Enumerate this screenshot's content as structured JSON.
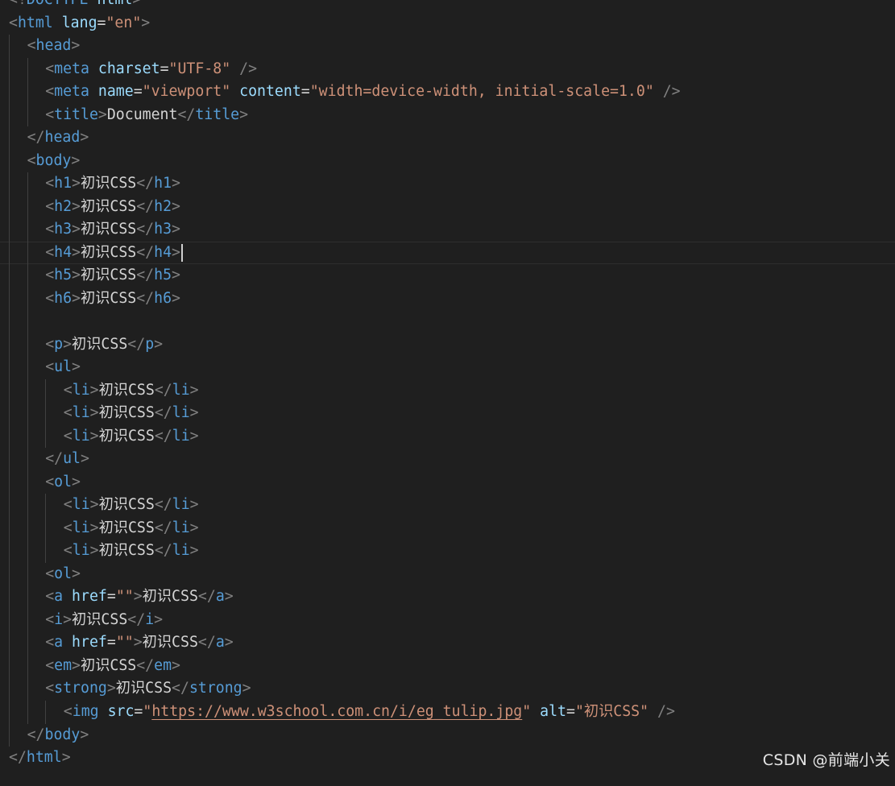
{
  "editor": {
    "cursor_line": 11,
    "lines": [
      {
        "indent": 0,
        "tokens": [
          {
            "k": "punc",
            "t": "<!"
          },
          {
            "k": "tag",
            "t": "DOCTYPE"
          },
          {
            "k": "text",
            "t": " "
          },
          {
            "k": "attr",
            "t": "html"
          },
          {
            "k": "punc",
            "t": ">"
          }
        ]
      },
      {
        "indent": 0,
        "tokens": [
          {
            "k": "punc",
            "t": "<"
          },
          {
            "k": "tag",
            "t": "html"
          },
          {
            "k": "text",
            "t": " "
          },
          {
            "k": "attr",
            "t": "lang"
          },
          {
            "k": "op",
            "t": "="
          },
          {
            "k": "str",
            "t": "\"en\""
          },
          {
            "k": "punc",
            "t": ">"
          }
        ]
      },
      {
        "indent": 1,
        "tokens": [
          {
            "k": "punc",
            "t": "<"
          },
          {
            "k": "tag",
            "t": "head"
          },
          {
            "k": "punc",
            "t": ">"
          }
        ]
      },
      {
        "indent": 2,
        "tokens": [
          {
            "k": "punc",
            "t": "<"
          },
          {
            "k": "tag",
            "t": "meta"
          },
          {
            "k": "text",
            "t": " "
          },
          {
            "k": "attr",
            "t": "charset"
          },
          {
            "k": "op",
            "t": "="
          },
          {
            "k": "str",
            "t": "\"UTF-8\""
          },
          {
            "k": "text",
            "t": " "
          },
          {
            "k": "punc",
            "t": "/>"
          }
        ]
      },
      {
        "indent": 2,
        "tokens": [
          {
            "k": "punc",
            "t": "<"
          },
          {
            "k": "tag",
            "t": "meta"
          },
          {
            "k": "text",
            "t": " "
          },
          {
            "k": "attr",
            "t": "name"
          },
          {
            "k": "op",
            "t": "="
          },
          {
            "k": "str",
            "t": "\"viewport\""
          },
          {
            "k": "text",
            "t": " "
          },
          {
            "k": "attr",
            "t": "content"
          },
          {
            "k": "op",
            "t": "="
          },
          {
            "k": "str",
            "t": "\"width=device-width, initial-scale=1.0\""
          },
          {
            "k": "text",
            "t": " "
          },
          {
            "k": "punc",
            "t": "/>"
          }
        ]
      },
      {
        "indent": 2,
        "tokens": [
          {
            "k": "punc",
            "t": "<"
          },
          {
            "k": "tag",
            "t": "title"
          },
          {
            "k": "punc",
            "t": ">"
          },
          {
            "k": "text",
            "t": "Document"
          },
          {
            "k": "punc",
            "t": "</"
          },
          {
            "k": "tag",
            "t": "title"
          },
          {
            "k": "punc",
            "t": ">"
          }
        ]
      },
      {
        "indent": 1,
        "tokens": [
          {
            "k": "punc",
            "t": "</"
          },
          {
            "k": "tag",
            "t": "head"
          },
          {
            "k": "punc",
            "t": ">"
          }
        ]
      },
      {
        "indent": 1,
        "tokens": [
          {
            "k": "punc",
            "t": "<"
          },
          {
            "k": "tag",
            "t": "body"
          },
          {
            "k": "punc",
            "t": ">"
          }
        ]
      },
      {
        "indent": 2,
        "tokens": [
          {
            "k": "punc",
            "t": "<"
          },
          {
            "k": "tag",
            "t": "h1"
          },
          {
            "k": "punc",
            "t": ">"
          },
          {
            "k": "text",
            "t": "初识CSS"
          },
          {
            "k": "punc",
            "t": "</"
          },
          {
            "k": "tag",
            "t": "h1"
          },
          {
            "k": "punc",
            "t": ">"
          }
        ]
      },
      {
        "indent": 2,
        "tokens": [
          {
            "k": "punc",
            "t": "<"
          },
          {
            "k": "tag",
            "t": "h2"
          },
          {
            "k": "punc",
            "t": ">"
          },
          {
            "k": "text",
            "t": "初识CSS"
          },
          {
            "k": "punc",
            "t": "</"
          },
          {
            "k": "tag",
            "t": "h2"
          },
          {
            "k": "punc",
            "t": ">"
          }
        ]
      },
      {
        "indent": 2,
        "tokens": [
          {
            "k": "punc",
            "t": "<"
          },
          {
            "k": "tag",
            "t": "h3"
          },
          {
            "k": "punc",
            "t": ">"
          },
          {
            "k": "text",
            "t": "初识CSS"
          },
          {
            "k": "punc",
            "t": "</"
          },
          {
            "k": "tag",
            "t": "h3"
          },
          {
            "k": "punc",
            "t": ">"
          }
        ]
      },
      {
        "indent": 2,
        "tokens": [
          {
            "k": "punc",
            "t": "<"
          },
          {
            "k": "tag",
            "t": "h4"
          },
          {
            "k": "punc",
            "t": ">"
          },
          {
            "k": "text",
            "t": "初识CSS"
          },
          {
            "k": "punc",
            "t": "</"
          },
          {
            "k": "tag",
            "t": "h4"
          },
          {
            "k": "punc",
            "t": ">"
          }
        ]
      },
      {
        "indent": 2,
        "tokens": [
          {
            "k": "punc",
            "t": "<"
          },
          {
            "k": "tag",
            "t": "h5"
          },
          {
            "k": "punc",
            "t": ">"
          },
          {
            "k": "text",
            "t": "初识CSS"
          },
          {
            "k": "punc",
            "t": "</"
          },
          {
            "k": "tag",
            "t": "h5"
          },
          {
            "k": "punc",
            "t": ">"
          }
        ]
      },
      {
        "indent": 2,
        "tokens": [
          {
            "k": "punc",
            "t": "<"
          },
          {
            "k": "tag",
            "t": "h6"
          },
          {
            "k": "punc",
            "t": ">"
          },
          {
            "k": "text",
            "t": "初识CSS"
          },
          {
            "k": "punc",
            "t": "</"
          },
          {
            "k": "tag",
            "t": "h6"
          },
          {
            "k": "punc",
            "t": ">"
          }
        ]
      },
      {
        "indent": 2,
        "tokens": []
      },
      {
        "indent": 2,
        "tokens": [
          {
            "k": "punc",
            "t": "<"
          },
          {
            "k": "tag",
            "t": "p"
          },
          {
            "k": "punc",
            "t": ">"
          },
          {
            "k": "text",
            "t": "初识CSS"
          },
          {
            "k": "punc",
            "t": "</"
          },
          {
            "k": "tag",
            "t": "p"
          },
          {
            "k": "punc",
            "t": ">"
          }
        ]
      },
      {
        "indent": 2,
        "tokens": [
          {
            "k": "punc",
            "t": "<"
          },
          {
            "k": "tag",
            "t": "ul"
          },
          {
            "k": "punc",
            "t": ">"
          }
        ]
      },
      {
        "indent": 3,
        "tokens": [
          {
            "k": "punc",
            "t": "<"
          },
          {
            "k": "tag",
            "t": "li"
          },
          {
            "k": "punc",
            "t": ">"
          },
          {
            "k": "text",
            "t": "初识CSS"
          },
          {
            "k": "punc",
            "t": "</"
          },
          {
            "k": "tag",
            "t": "li"
          },
          {
            "k": "punc",
            "t": ">"
          }
        ]
      },
      {
        "indent": 3,
        "tokens": [
          {
            "k": "punc",
            "t": "<"
          },
          {
            "k": "tag",
            "t": "li"
          },
          {
            "k": "punc",
            "t": ">"
          },
          {
            "k": "text",
            "t": "初识CSS"
          },
          {
            "k": "punc",
            "t": "</"
          },
          {
            "k": "tag",
            "t": "li"
          },
          {
            "k": "punc",
            "t": ">"
          }
        ]
      },
      {
        "indent": 3,
        "tokens": [
          {
            "k": "punc",
            "t": "<"
          },
          {
            "k": "tag",
            "t": "li"
          },
          {
            "k": "punc",
            "t": ">"
          },
          {
            "k": "text",
            "t": "初识CSS"
          },
          {
            "k": "punc",
            "t": "</"
          },
          {
            "k": "tag",
            "t": "li"
          },
          {
            "k": "punc",
            "t": ">"
          }
        ]
      },
      {
        "indent": 2,
        "tokens": [
          {
            "k": "punc",
            "t": "</"
          },
          {
            "k": "tag",
            "t": "ul"
          },
          {
            "k": "punc",
            "t": ">"
          }
        ]
      },
      {
        "indent": 2,
        "tokens": [
          {
            "k": "punc",
            "t": "<"
          },
          {
            "k": "tag",
            "t": "ol"
          },
          {
            "k": "punc",
            "t": ">"
          }
        ]
      },
      {
        "indent": 3,
        "tokens": [
          {
            "k": "punc",
            "t": "<"
          },
          {
            "k": "tag",
            "t": "li"
          },
          {
            "k": "punc",
            "t": ">"
          },
          {
            "k": "text",
            "t": "初识CSS"
          },
          {
            "k": "punc",
            "t": "</"
          },
          {
            "k": "tag",
            "t": "li"
          },
          {
            "k": "punc",
            "t": ">"
          }
        ]
      },
      {
        "indent": 3,
        "tokens": [
          {
            "k": "punc",
            "t": "<"
          },
          {
            "k": "tag",
            "t": "li"
          },
          {
            "k": "punc",
            "t": ">"
          },
          {
            "k": "text",
            "t": "初识CSS"
          },
          {
            "k": "punc",
            "t": "</"
          },
          {
            "k": "tag",
            "t": "li"
          },
          {
            "k": "punc",
            "t": ">"
          }
        ]
      },
      {
        "indent": 3,
        "tokens": [
          {
            "k": "punc",
            "t": "<"
          },
          {
            "k": "tag",
            "t": "li"
          },
          {
            "k": "punc",
            "t": ">"
          },
          {
            "k": "text",
            "t": "初识CSS"
          },
          {
            "k": "punc",
            "t": "</"
          },
          {
            "k": "tag",
            "t": "li"
          },
          {
            "k": "punc",
            "t": ">"
          }
        ]
      },
      {
        "indent": 2,
        "tokens": [
          {
            "k": "punc",
            "t": "<"
          },
          {
            "k": "tag",
            "t": "ol"
          },
          {
            "k": "punc",
            "t": ">"
          }
        ]
      },
      {
        "indent": 2,
        "tokens": [
          {
            "k": "punc",
            "t": "<"
          },
          {
            "k": "tag",
            "t": "a"
          },
          {
            "k": "text",
            "t": " "
          },
          {
            "k": "attr",
            "t": "href"
          },
          {
            "k": "op",
            "t": "="
          },
          {
            "k": "str",
            "t": "\"\""
          },
          {
            "k": "punc",
            "t": ">"
          },
          {
            "k": "text",
            "t": "初识CSS"
          },
          {
            "k": "punc",
            "t": "</"
          },
          {
            "k": "tag",
            "t": "a"
          },
          {
            "k": "punc",
            "t": ">"
          }
        ]
      },
      {
        "indent": 2,
        "tokens": [
          {
            "k": "punc",
            "t": "<"
          },
          {
            "k": "tag",
            "t": "i"
          },
          {
            "k": "punc",
            "t": ">"
          },
          {
            "k": "text",
            "t": "初识CSS"
          },
          {
            "k": "punc",
            "t": "</"
          },
          {
            "k": "tag",
            "t": "i"
          },
          {
            "k": "punc",
            "t": ">"
          }
        ]
      },
      {
        "indent": 2,
        "tokens": [
          {
            "k": "punc",
            "t": "<"
          },
          {
            "k": "tag",
            "t": "a"
          },
          {
            "k": "text",
            "t": " "
          },
          {
            "k": "attr",
            "t": "href"
          },
          {
            "k": "op",
            "t": "="
          },
          {
            "k": "str",
            "t": "\"\""
          },
          {
            "k": "punc",
            "t": ">"
          },
          {
            "k": "text",
            "t": "初识CSS"
          },
          {
            "k": "punc",
            "t": "</"
          },
          {
            "k": "tag",
            "t": "a"
          },
          {
            "k": "punc",
            "t": ">"
          }
        ]
      },
      {
        "indent": 2,
        "tokens": [
          {
            "k": "punc",
            "t": "<"
          },
          {
            "k": "tag",
            "t": "em"
          },
          {
            "k": "punc",
            "t": ">"
          },
          {
            "k": "text",
            "t": "初识CSS"
          },
          {
            "k": "punc",
            "t": "</"
          },
          {
            "k": "tag",
            "t": "em"
          },
          {
            "k": "punc",
            "t": ">"
          }
        ]
      },
      {
        "indent": 2,
        "tokens": [
          {
            "k": "punc",
            "t": "<"
          },
          {
            "k": "tag",
            "t": "strong"
          },
          {
            "k": "punc",
            "t": ">"
          },
          {
            "k": "text",
            "t": "初识CSS"
          },
          {
            "k": "punc",
            "t": "</"
          },
          {
            "k": "tag",
            "t": "strong"
          },
          {
            "k": "punc",
            "t": ">"
          }
        ]
      },
      {
        "indent": 3,
        "tokens": [
          {
            "k": "punc",
            "t": "<"
          },
          {
            "k": "tag",
            "t": "img"
          },
          {
            "k": "text",
            "t": " "
          },
          {
            "k": "attr",
            "t": "src"
          },
          {
            "k": "op",
            "t": "="
          },
          {
            "k": "str",
            "t": "\""
          },
          {
            "k": "url",
            "t": "https://www.w3school.com.cn/i/eg_tulip.jpg"
          },
          {
            "k": "str",
            "t": "\""
          },
          {
            "k": "text",
            "t": " "
          },
          {
            "k": "attr",
            "t": "alt"
          },
          {
            "k": "op",
            "t": "="
          },
          {
            "k": "str",
            "t": "\"初识CSS\""
          },
          {
            "k": "text",
            "t": " "
          },
          {
            "k": "punc",
            "t": "/>"
          }
        ]
      },
      {
        "indent": 1,
        "tokens": [
          {
            "k": "punc",
            "t": "</"
          },
          {
            "k": "tag",
            "t": "body"
          },
          {
            "k": "punc",
            "t": ">"
          }
        ]
      },
      {
        "indent": 0,
        "tokens": [
          {
            "k": "punc",
            "t": "</"
          },
          {
            "k": "tag",
            "t": "html"
          },
          {
            "k": "punc",
            "t": ">"
          }
        ]
      }
    ]
  },
  "watermark": {
    "text": "CSDN @前端小关"
  },
  "colors": {
    "background": "#1f1f1f",
    "tag": "#569cd6",
    "attribute": "#9cdcfe",
    "string": "#ce9178",
    "punctuation": "#808080",
    "text": "#d4d4d4"
  }
}
